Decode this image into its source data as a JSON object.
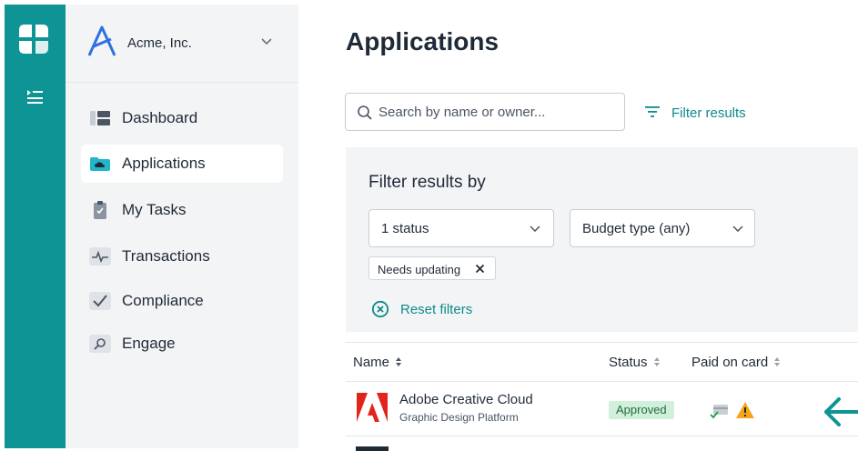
{
  "org": {
    "name": "Acme, Inc."
  },
  "sidebar": {
    "items": [
      {
        "label": "Dashboard",
        "icon": "dashboard-icon",
        "active": false
      },
      {
        "label": "Applications",
        "icon": "cloud-folder-icon",
        "active": true
      },
      {
        "label": "My Tasks",
        "icon": "clipboard-icon",
        "active": false
      },
      {
        "label": "Transactions",
        "icon": "pulse-icon",
        "active": false
      },
      {
        "label": "Compliance",
        "icon": "checkmark-icon",
        "active": false
      },
      {
        "label": "Engage",
        "icon": "magnifier-icon",
        "active": false
      }
    ]
  },
  "page": {
    "title": "Applications"
  },
  "search": {
    "placeholder": "Search by name or owner..."
  },
  "toolbar": {
    "filter_label": "Filter results"
  },
  "filters": {
    "heading": "Filter results by",
    "status_select": "1 status",
    "budget_select": "Budget type (any)",
    "chip": "Needs updating",
    "reset_label": "Reset filters"
  },
  "table": {
    "columns": [
      "Name",
      "Status",
      "Paid on card"
    ],
    "rows": [
      {
        "name": "Adobe Creative Cloud",
        "category": "Graphic Design Platform",
        "status": "Approved",
        "paid_on_card_icons": [
          "card-check-icon",
          "warning-icon"
        ]
      }
    ]
  },
  "colors": {
    "brand": "#0e9494",
    "accent_text": "#0e8a8a",
    "sidebar_bg": "#f3f4f6",
    "approved_bg": "#d1f0dc",
    "warning": "#f4a51c"
  }
}
